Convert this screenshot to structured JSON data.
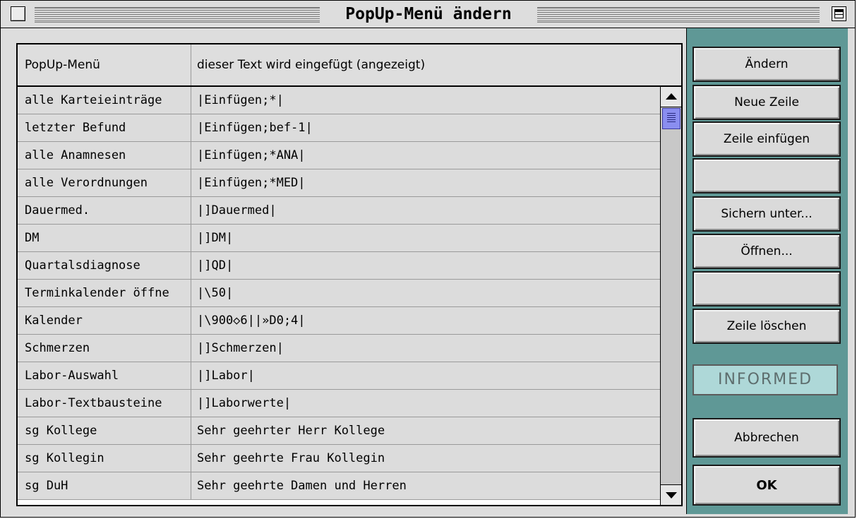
{
  "window": {
    "title": "PopUp-Menü ändern"
  },
  "table": {
    "columns": [
      "PopUp-Menü",
      "dieser Text wird eingefügt (angezeigt)"
    ],
    "rows": [
      [
        "alle Karteieinträge",
        "|Einfügen;*|"
      ],
      [
        "letzter Befund",
        "|Einfügen;bef-1|"
      ],
      [
        "alle Anamnesen",
        "|Einfügen;*ANA|"
      ],
      [
        "alle Verordnungen",
        "|Einfügen;*MED|"
      ],
      [
        "Dauermed.",
        "|]Dauermed|"
      ],
      [
        "DM",
        "|]DM|"
      ],
      [
        "Quartalsdiagnose",
        "|]QD|"
      ],
      [
        "Terminkalender öffne",
        "|\\50|"
      ],
      [
        "Kalender",
        "|\\900◇6||»D0;4|"
      ],
      [
        "Schmerzen",
        "|]Schmerzen|"
      ],
      [
        "Labor-Auswahl",
        "|]Labor|"
      ],
      [
        "Labor-Textbausteine",
        "|]Laborwerte|"
      ],
      [
        "sg Kollege",
        "Sehr geehrter Herr Kollege"
      ],
      [
        "sg Kollegin",
        "Sehr geehrte Frau Kollegin"
      ],
      [
        "sg DuH",
        "Sehr geehrte Damen und Herren"
      ]
    ]
  },
  "buttons": {
    "aendern": "Ändern",
    "neue_zeile": "Neue Zeile",
    "zeile_einfuegen": "Zeile einfügen",
    "blank1": "",
    "sichern_unter": "Sichern unter...",
    "oeffnen": "Öffnen...",
    "blank2": "",
    "zeile_loeschen": "Zeile löschen",
    "abbrechen": "Abbrechen",
    "ok": "OK"
  },
  "brand": {
    "logo_text": "INFORMED"
  },
  "scrollbar": {
    "position_fraction": 0.0
  },
  "colors": {
    "side_panel": "#5f9896",
    "logo_bg": "#aed8d8",
    "scroll_thumb": "#8a8ef0"
  },
  "icons": {
    "close": "close-box-icon",
    "zoom": "zoom-box-icon",
    "up": "arrow-up-icon",
    "down": "arrow-down-icon"
  }
}
